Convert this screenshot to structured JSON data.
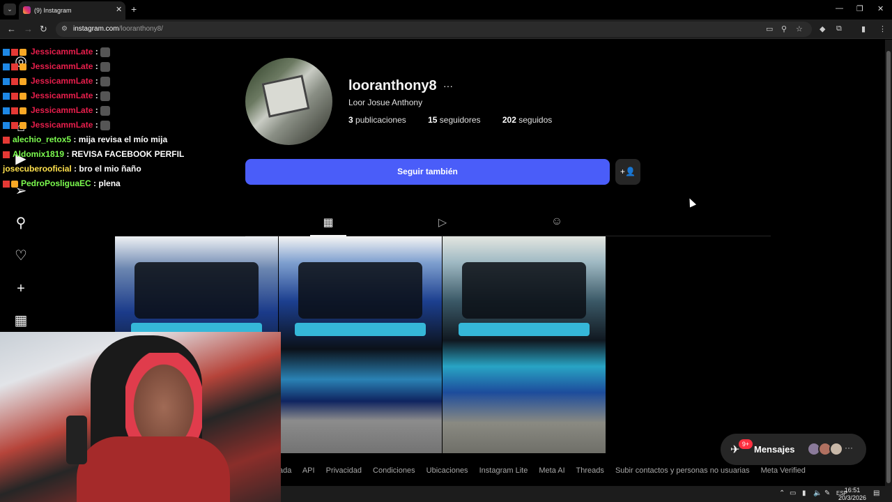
{
  "browser": {
    "tab_title": "(9) Instagram",
    "url_host": "instagram.com",
    "url_path": "/looranthony8/",
    "new_tab_glyph": "+",
    "close_glyph": "✕"
  },
  "chat": [
    {
      "user": "JessicammLate",
      "msg": ":"
    },
    {
      "user": "JessicammLate",
      "msg": ":"
    },
    {
      "user": "JessicammLate",
      "msg": ":"
    },
    {
      "user": "JessicammLate",
      "msg": ":"
    },
    {
      "user": "JessicammLate",
      "msg": ":"
    },
    {
      "user": "JessicammLate",
      "msg": ":"
    },
    {
      "user": "alechio_retox5",
      "msg": ": mija revisa el mío mija"
    },
    {
      "user": "Aldomix1819",
      "msg": ": REVISA FACEBOOK PERFIL"
    },
    {
      "user": "josecuberooficial",
      "msg": ": bro el mio ñaño"
    },
    {
      "user": "PedroPosliguaEC",
      "msg": ": plena"
    }
  ],
  "profile": {
    "username": "looranthony8",
    "more": "···",
    "full_name": "Loor Josue Anthony",
    "posts_count": "3",
    "posts_label": "publicaciones",
    "followers_count": "15",
    "followers_label": "seguidores",
    "following_count": "202",
    "following_label": "seguidos",
    "follow_button": "Seguir también",
    "suggest_icon": "+👤"
  },
  "tabs": [
    {
      "name": "posts",
      "icon": "grid-icon"
    },
    {
      "name": "reels",
      "icon": "reels-icon"
    },
    {
      "name": "tagged",
      "icon": "tagged-icon"
    }
  ],
  "footer": {
    "links": [
      "ada",
      "API",
      "Privacidad",
      "Condiciones",
      "Ubicaciones",
      "Instagram Lite",
      "Meta AI",
      "Threads",
      "Subir contactos y personas no usuarias",
      "Meta Verified"
    ]
  },
  "messages": {
    "label": "Mensajes",
    "badge": "9+",
    "more": "···"
  },
  "taskbar": {
    "lang": "ESP",
    "time": "16:51",
    "date": "20/3/2026"
  },
  "colors": {
    "follow_blue": "#4a5df9",
    "chat_user_red": "#e91e4c",
    "badge_red": "#ff3040"
  }
}
